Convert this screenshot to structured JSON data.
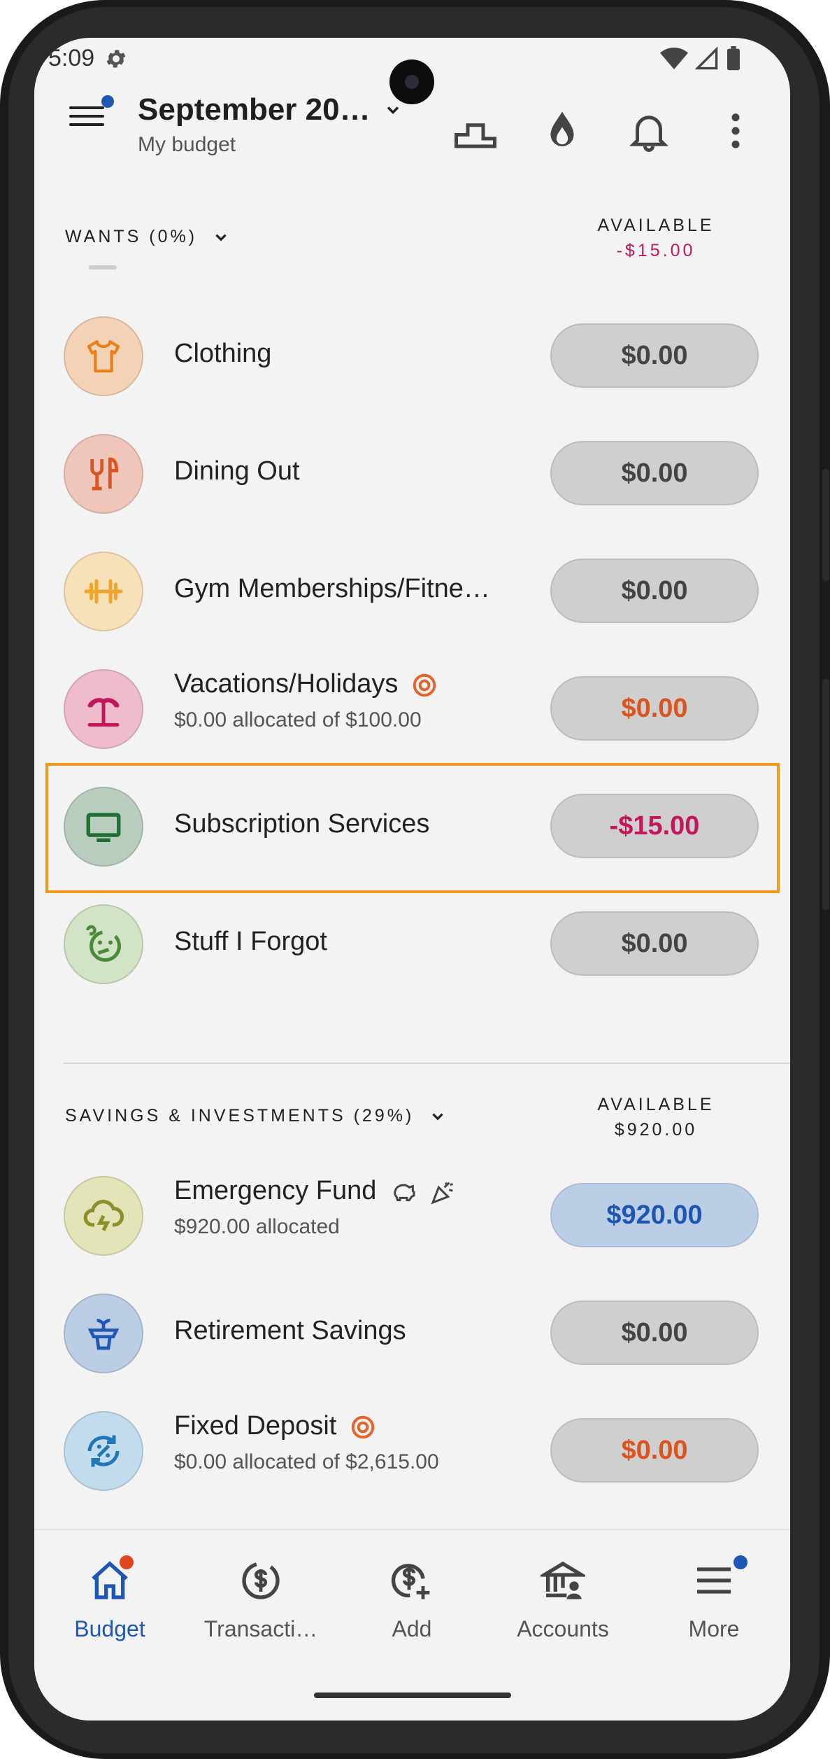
{
  "status_bar": {
    "time": "5:09"
  },
  "header": {
    "title": "September 20…",
    "subtitle": "My budget"
  },
  "wants_section": {
    "title": "WANTS (0%)",
    "available_label": "AVAILABLE",
    "available_value": "-$15.00",
    "rows": [
      {
        "name": "Clothing",
        "amount": "$0.00",
        "icon": "shirt-icon"
      },
      {
        "name": "Dining Out",
        "amount": "$0.00",
        "icon": "utensils-icon"
      },
      {
        "name": "Gym Memberships/Fitne…",
        "amount": "$0.00",
        "icon": "dumbbell-icon"
      },
      {
        "name": "Vacations/Holidays",
        "sub": "$0.00 allocated of $100.00",
        "amount": "$0.00",
        "icon": "palm-tree-icon"
      },
      {
        "name": "Subscription Services",
        "amount": "-$15.00",
        "icon": "tv-icon"
      },
      {
        "name": "Stuff I Forgot",
        "amount": "$0.00",
        "icon": "confused-face-icon"
      }
    ]
  },
  "savings_section": {
    "title": "SAVINGS & INVESTMENTS (29%)",
    "available_label": "AVAILABLE",
    "available_value": "$920.00",
    "rows": [
      {
        "name": "Emergency Fund",
        "sub": "$920.00 allocated",
        "amount": "$920.00",
        "icon": "storm-cloud-icon"
      },
      {
        "name": "Retirement Savings",
        "amount": "$0.00",
        "icon": "plant-pot-icon"
      },
      {
        "name": "Fixed Deposit",
        "sub": "$0.00 allocated of $2,615.00",
        "amount": "$0.00",
        "icon": "percent-cycle-icon"
      }
    ]
  },
  "bottom_nav": [
    {
      "label": "Budget"
    },
    {
      "label": "Transacti…"
    },
    {
      "label": "Add"
    },
    {
      "label": "Accounts"
    },
    {
      "label": "More"
    }
  ],
  "colors": {
    "accent": "#1e56b3",
    "negative": "#c2185b",
    "warning": "#d9541e",
    "highlight": "#f09a1a"
  }
}
